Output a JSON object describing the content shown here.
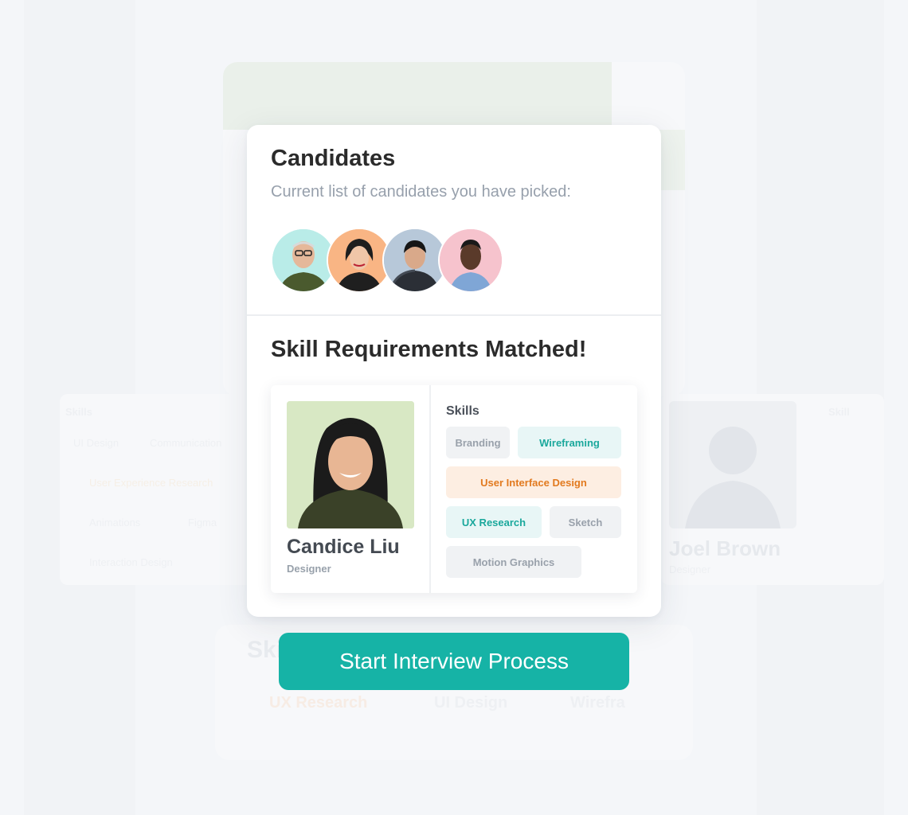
{
  "candidates": {
    "title": "Candidates",
    "subtitle": "Current list of candidates you have picked:",
    "avatars": [
      {
        "icon": "candidate-avatar-1",
        "bg": "#b9ece8"
      },
      {
        "icon": "candidate-avatar-2",
        "bg": "#f9b584"
      },
      {
        "icon": "candidate-avatar-3",
        "bg": "#b7c8d9"
      },
      {
        "icon": "candidate-avatar-4",
        "bg": "#f6c3cd"
      }
    ]
  },
  "match": {
    "title": "Skill Requirements Matched!",
    "candidate": {
      "name": "Candice Liu",
      "role": "Designer"
    },
    "skills_label": "Skills",
    "skills": [
      {
        "label": "Branding",
        "style": "gray"
      },
      {
        "label": "Wireframing",
        "style": "teal"
      },
      {
        "label": "User Interface Design",
        "style": "orange"
      },
      {
        "label": "UX Research",
        "style": "teal"
      },
      {
        "label": "Sketch",
        "style": "gray"
      },
      {
        "label": "Motion Graphics",
        "style": "gray"
      }
    ]
  },
  "background": {
    "skills_left": "Skills",
    "skills_right": "Skill",
    "tags_left": [
      "UI Design",
      "Communication",
      "User Experience Research",
      "Animations",
      "Figma",
      "Interaction Design"
    ],
    "person_name": "Joel Brown",
    "person_role": "Designer",
    "bottom_title": "Ski",
    "bottom_tags": [
      "UX Research",
      "UI Design",
      "Wirefra"
    ]
  },
  "cta": {
    "label": "Start Interview Process"
  },
  "colors": {
    "accent": "#16b3a6",
    "teal_text": "#1aa89c",
    "orange_text": "#e27a1f"
  }
}
